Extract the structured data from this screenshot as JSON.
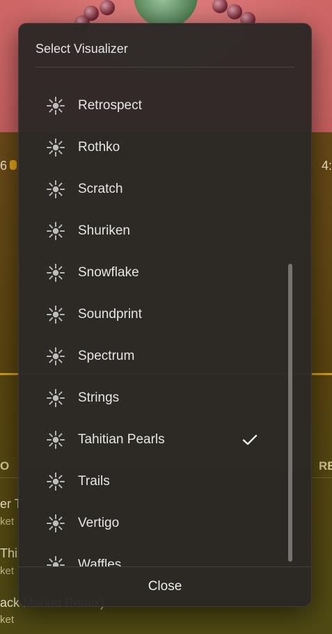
{
  "background": {
    "time_left": "6",
    "time_right": "4:",
    "column_left": "O",
    "column_right": "RE",
    "tracks": [
      {
        "title": "er T",
        "sub": "ket"
      },
      {
        "title": "Thi",
        "sub": "ket"
      },
      {
        "title": "ack Market Remix)",
        "sub": "ket"
      }
    ]
  },
  "dialog": {
    "title": "Select Visualizer",
    "selected": "Tahitian Pearls",
    "items": [
      {
        "label": "Retrospect",
        "icon": "visualizer-icon"
      },
      {
        "label": "Rothko",
        "icon": "visualizer-icon"
      },
      {
        "label": "Scratch",
        "icon": "visualizer-icon"
      },
      {
        "label": "Shuriken",
        "icon": "visualizer-icon"
      },
      {
        "label": "Snowflake",
        "icon": "visualizer-icon"
      },
      {
        "label": "Soundprint",
        "icon": "visualizer-icon"
      },
      {
        "label": "Spectrum",
        "icon": "visualizer-icon"
      },
      {
        "label": "Strings",
        "icon": "visualizer-icon"
      },
      {
        "label": "Tahitian Pearls",
        "icon": "visualizer-icon",
        "checked": true
      },
      {
        "label": "Trails",
        "icon": "visualizer-icon"
      },
      {
        "label": "Vertigo",
        "icon": "visualizer-icon"
      },
      {
        "label": "Waffles",
        "icon": "visualizer-icon"
      }
    ],
    "close_label": "Close"
  },
  "colors": {
    "dialog_bg": "#2b2826",
    "text": "#e6e6e6",
    "accent_progress": "#d4a017"
  }
}
